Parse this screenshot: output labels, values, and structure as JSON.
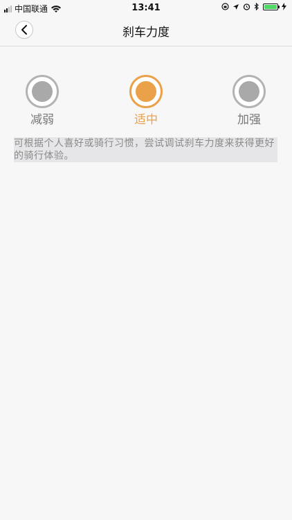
{
  "status_bar": {
    "carrier": "中国联通",
    "time": "13:41"
  },
  "nav": {
    "title": "刹车力度",
    "back_icon": "chevron-left-icon"
  },
  "options": [
    {
      "label": "减弱",
      "selected": false
    },
    {
      "label": "适中",
      "selected": true
    },
    {
      "label": "加强",
      "selected": false
    }
  ],
  "description": "可根据个人喜好或骑行习惯，尝试调试刹车力度来获得更好的骑行体验。",
  "colors": {
    "accent": "#eba04a",
    "inactive": "#a9a9a9",
    "background": "#f7f7f7"
  }
}
